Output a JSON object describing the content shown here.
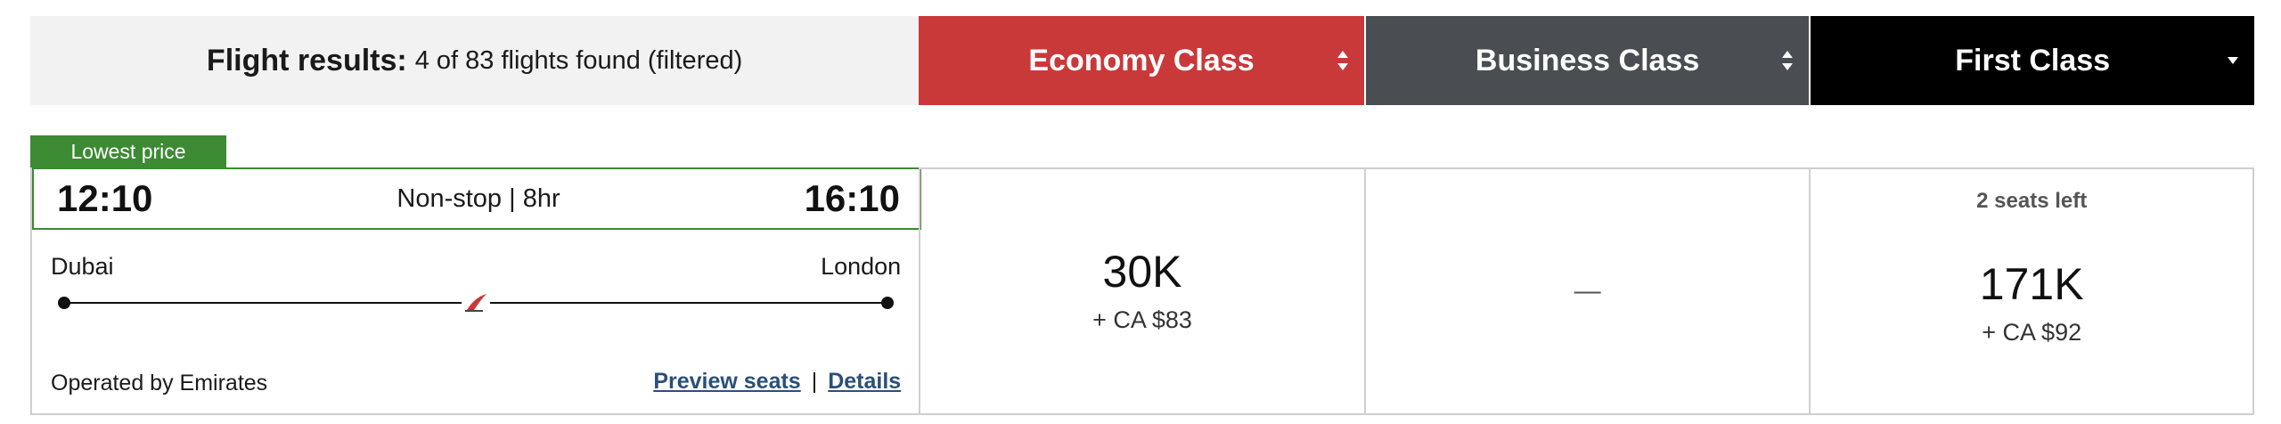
{
  "results": {
    "lead": "Flight results:",
    "summary": "4 of 83 flights found (filtered)"
  },
  "classes": [
    {
      "label": "Economy Class",
      "color": "#c9393a",
      "sort_icon": "sort-both-icon"
    },
    {
      "label": "Business Class",
      "color": "#4a4d51",
      "sort_icon": "sort-both-icon"
    },
    {
      "label": "First Class",
      "color": "#000000",
      "sort_icon": "sort-down-icon"
    }
  ],
  "flight": {
    "badge": "Lowest price",
    "depart_time": "12:10",
    "arrive_time": "16:10",
    "duration": "Non-stop | 8hr",
    "origin": "Dubai",
    "destination": "London",
    "airline_icon": "airline-logo-icon",
    "operated_by": "Operated by Emirates",
    "preview_link": "Preview seats",
    "separator": "|",
    "details_link": "Details"
  },
  "fares": {
    "economy": {
      "points": "30K",
      "cash": "+ CA $83"
    },
    "business": {
      "unavailable": "—"
    },
    "first": {
      "seats_left": "2 seats left",
      "points": "171K",
      "cash": "+ CA $92"
    }
  },
  "colors": {
    "highlight_green": "#3c8a32",
    "link": "#2a4f7a",
    "summary_bg": "#f2f2f2"
  }
}
